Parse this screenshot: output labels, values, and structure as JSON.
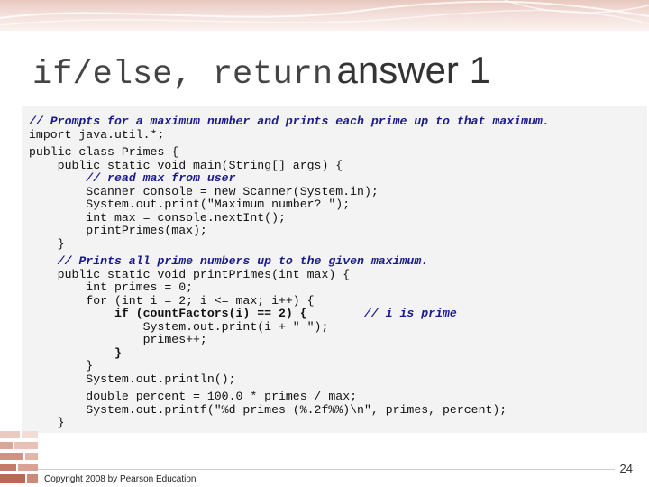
{
  "slide": {
    "title_mono": "if/else, return",
    "title_sans": "answer 1",
    "copyright": "Copyright 2008 by Pearson Education",
    "page_number": "24"
  },
  "code": {
    "l1": "// Prompts for a maximum number and prints each prime up to that maximum.",
    "l2": "import java.util.*;",
    "l3": "public class Primes {",
    "l4": "    public static void main(String[] args) {",
    "l5": "        // read max from user",
    "l6": "        Scanner console = new Scanner(System.in);",
    "l7": "        System.out.print(\"Maximum number? \");",
    "l8": "        int max = console.nextInt();",
    "l9": "        printPrimes(max);",
    "l10": "    }",
    "l11": "    // Prints all prime numbers up to the given maximum.",
    "l12": "    public static void printPrimes(int max) {",
    "l13": "        int primes = 0;",
    "l14": "        for (int i = 2; i <= max; i++) {",
    "l15a": "            if (countFactors(i) == 2) {",
    "l15b": "        // i is prime",
    "l16": "                System.out.print(i + \" \");",
    "l17": "                primes++;",
    "l18": "            }",
    "l19": "        }",
    "l20": "        System.out.println();",
    "l21": "        double percent = 100.0 * primes / max;",
    "l22": "        System.out.printf(\"%d primes (%.2f%%)\\n\", primes, percent);",
    "l23": "    }"
  }
}
